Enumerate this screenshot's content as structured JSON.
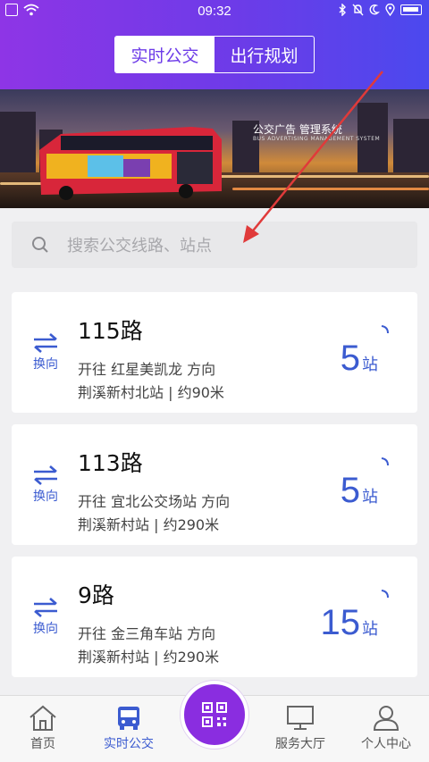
{
  "status_bar": {
    "time": "09:32"
  },
  "header": {
    "tabs": [
      {
        "label": "实时公交",
        "active": true
      },
      {
        "label": "出行规划",
        "active": false
      }
    ]
  },
  "banner": {
    "caption": "公交广告 管理系统",
    "caption_sub": "BUS ADVERTISING MANAGEMENT SYSTEM"
  },
  "search": {
    "placeholder": "搜索公交线路、站点"
  },
  "routes": [
    {
      "swap_label": "换向",
      "name": "115路",
      "direction": "开往 红星美凯龙 方向",
      "station": "荆溪新村北站 | 约90米",
      "eta_num": "5",
      "eta_unit": "站"
    },
    {
      "swap_label": "换向",
      "name": "113路",
      "direction": "开往 宜北公交场站 方向",
      "station": "荆溪新村站 | 约290米",
      "eta_num": "5",
      "eta_unit": "站"
    },
    {
      "swap_label": "换向",
      "name": "9路",
      "direction": "开往 金三角车站 方向",
      "station": "荆溪新村站 | 约290米",
      "eta_num": "15",
      "eta_unit": "站"
    }
  ],
  "bottom_nav": [
    {
      "label": "首页",
      "icon": "home-icon",
      "active": false
    },
    {
      "label": "实时公交",
      "icon": "bus-icon",
      "active": true
    },
    {
      "label": "服务大厅",
      "icon": "monitor-icon",
      "active": false
    },
    {
      "label": "个人中心",
      "icon": "user-icon",
      "active": false
    }
  ],
  "colors": {
    "accent": "#3b5bd0",
    "header_start": "#8e35e6",
    "header_end": "#4b49ee",
    "scan_button": "#8a2de0"
  }
}
